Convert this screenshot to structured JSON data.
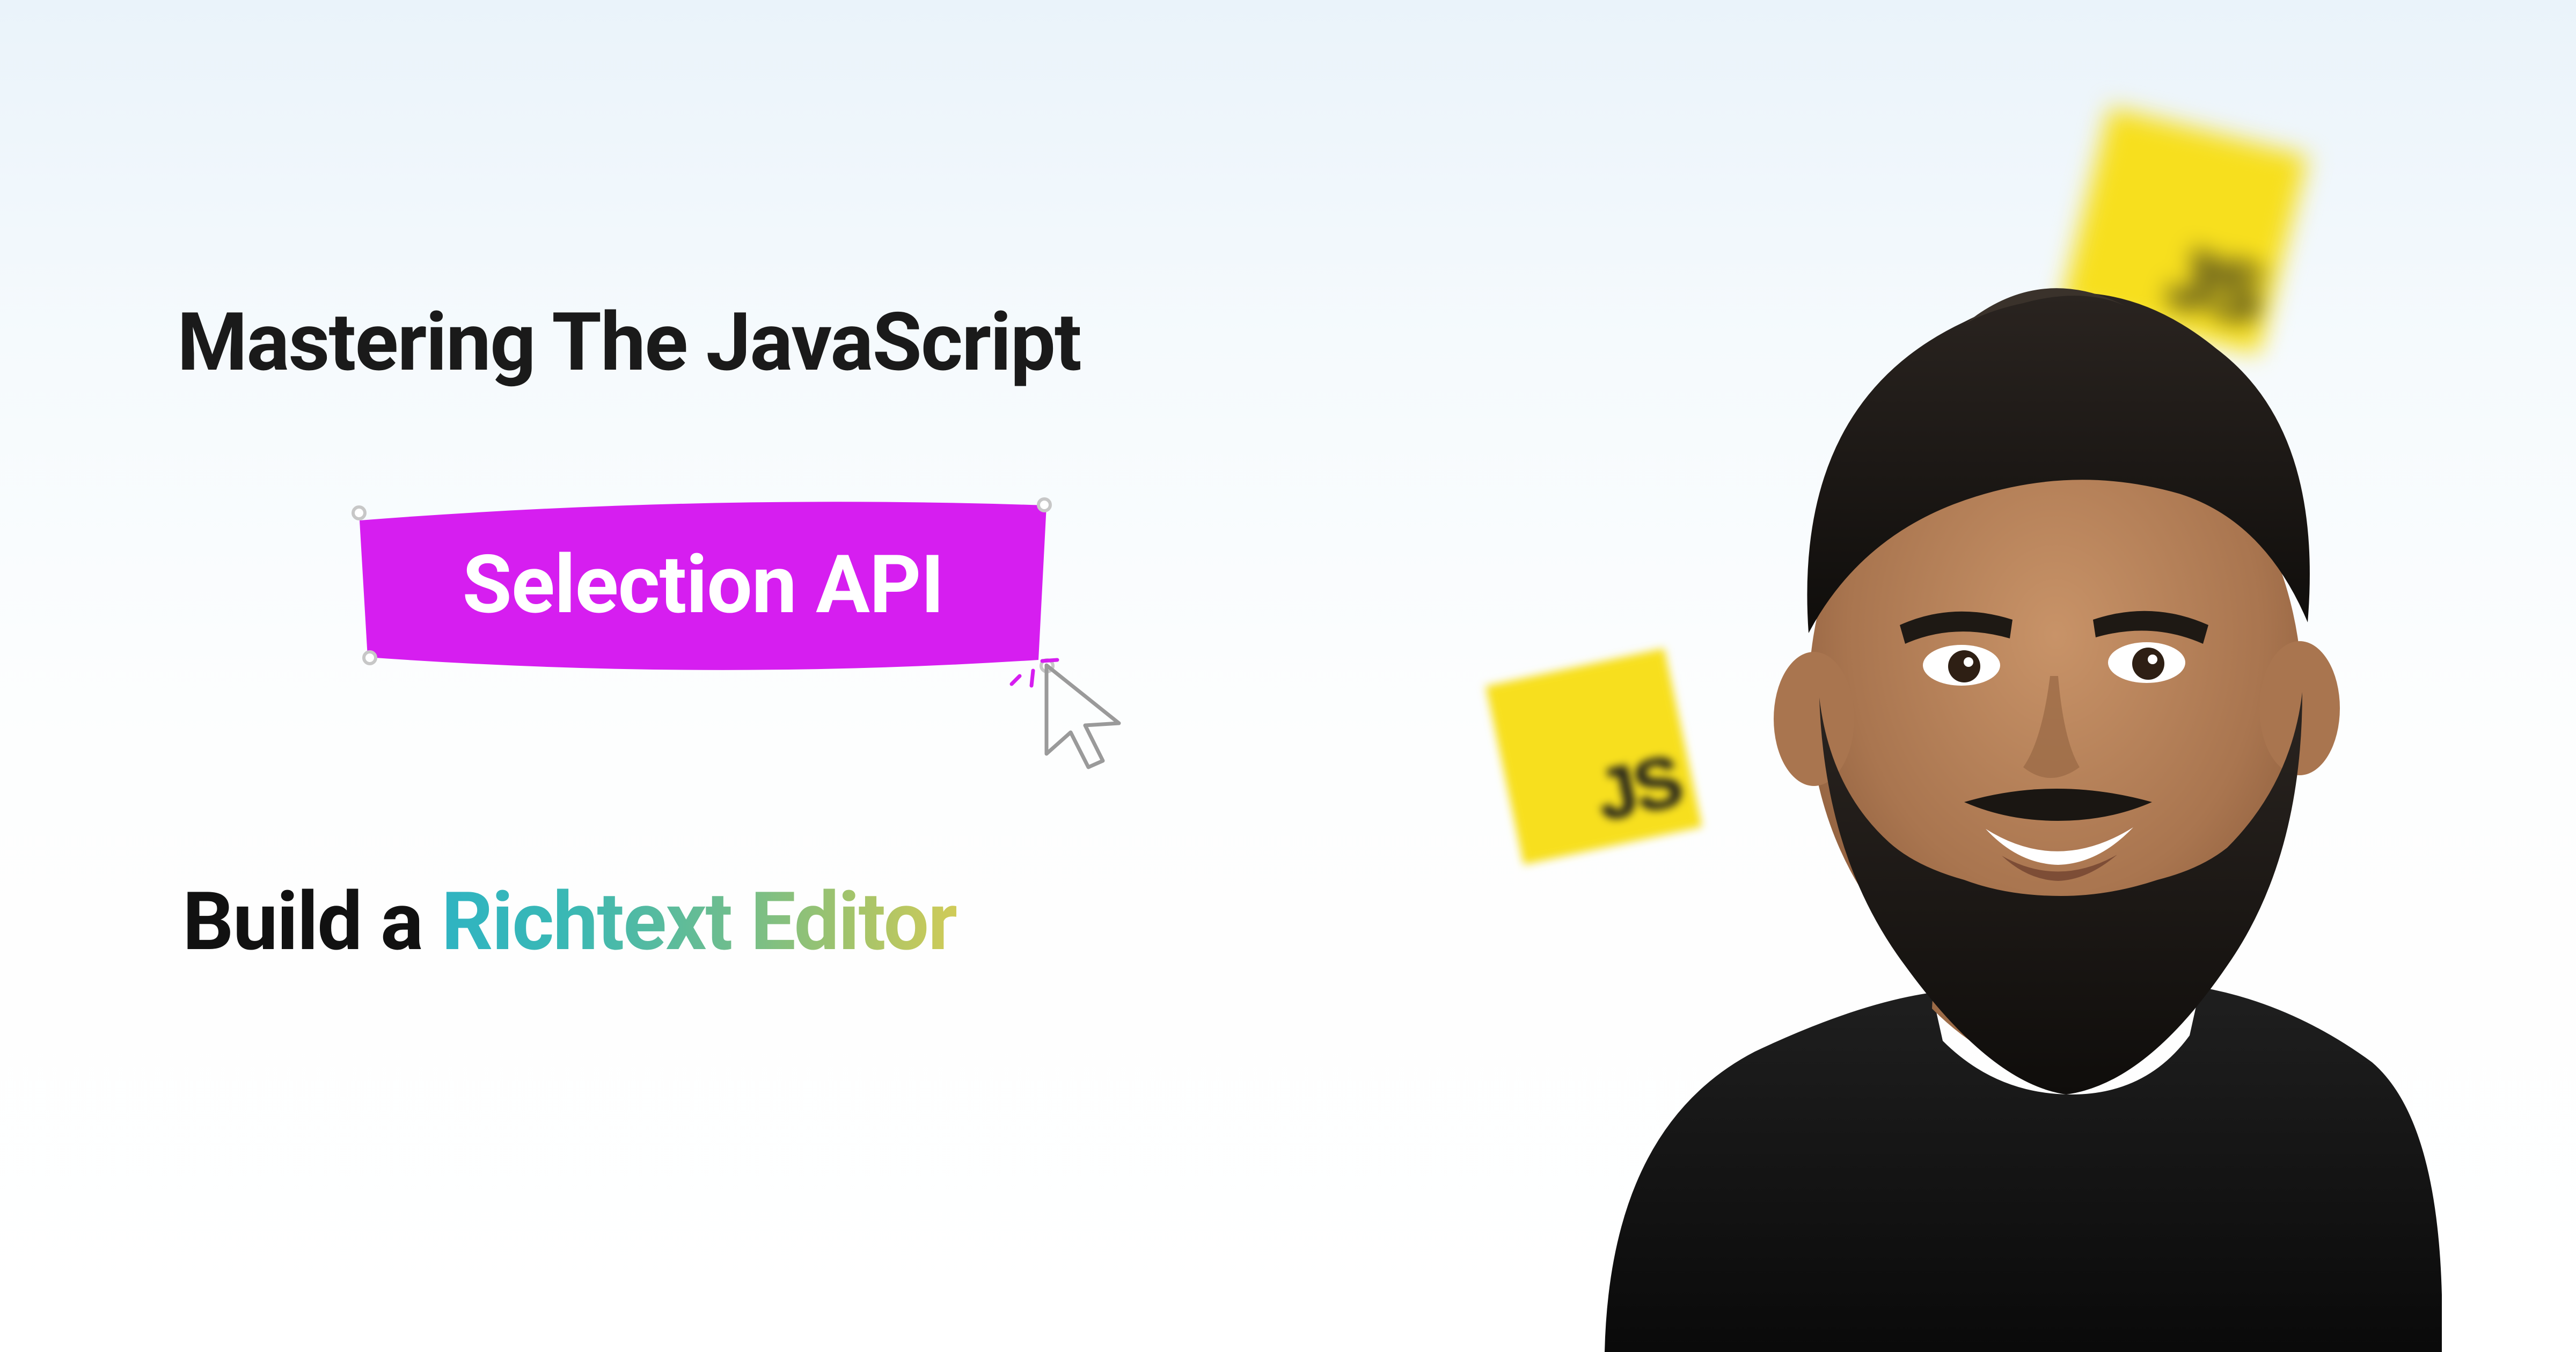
{
  "title_line1": "Mastering The JavaScript",
  "badge_text": "Selection API",
  "subtitle_prefix": "Build a ",
  "subtitle_highlight": "Richtext Editor",
  "js_logo_text": "JS",
  "colors": {
    "badge_bg": "#d61ef0",
    "gradient_start": "#2fb4c2",
    "gradient_end": "#d0cb58",
    "js_yellow": "#f7df1e"
  }
}
